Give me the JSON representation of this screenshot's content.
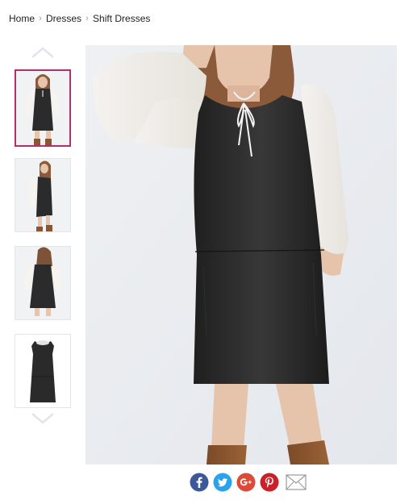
{
  "breadcrumb": {
    "items": [
      {
        "label": "Home"
      },
      {
        "label": "Dresses"
      },
      {
        "label": "Shift Dresses"
      }
    ],
    "separator": "›"
  },
  "gallery": {
    "up_icon": "chevron-up-icon",
    "down_icon": "chevron-down-icon",
    "thumbnails": [
      {
        "view": "front",
        "active": true
      },
      {
        "view": "side",
        "active": false
      },
      {
        "view": "back",
        "active": false
      },
      {
        "view": "flat",
        "active": false
      }
    ],
    "active_border_color": "#b3306d"
  },
  "product_image": {
    "subject": "model wearing black sleeveless faux-leather shift dress over white blouse with tie neck, tan knee boots"
  },
  "share": {
    "buttons": [
      {
        "icon": "facebook-icon",
        "color": "#3b5998"
      },
      {
        "icon": "twitter-icon",
        "color": "#2aa3ef"
      },
      {
        "icon": "google-plus-icon",
        "color": "#dc4a38"
      },
      {
        "icon": "pinterest-icon",
        "color": "#cb2027"
      },
      {
        "icon": "mail-icon",
        "color": "#9a9a9a"
      }
    ]
  }
}
